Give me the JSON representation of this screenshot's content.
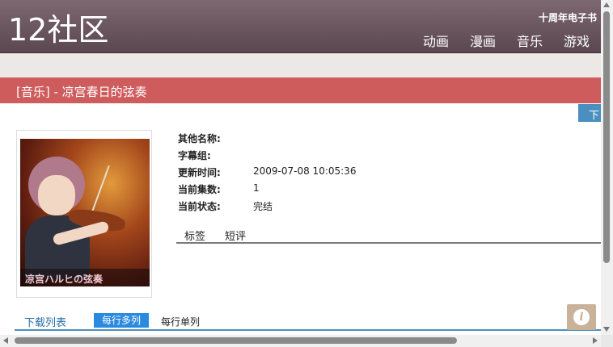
{
  "header": {
    "logo": "12社区",
    "anniversary": "十周年电子书",
    "nav": [
      "动画",
      "漫画",
      "音乐",
      "游戏"
    ]
  },
  "page": {
    "title": "[音乐] - 凉宫春日的弦奏",
    "download_tab": "下"
  },
  "cover": {
    "caption": "凉宫ハルヒの弦奏"
  },
  "info": {
    "rows": [
      {
        "label": "其他名称:",
        "value": ""
      },
      {
        "label": "字幕组:",
        "value": ""
      },
      {
        "label": "更新时间:",
        "value": "2009-07-08 10:05:36"
      },
      {
        "label": "当前集数:",
        "value": "1"
      },
      {
        "label": "当前状态:",
        "value": "完结"
      }
    ]
  },
  "tabs": [
    "标签",
    "短评"
  ],
  "download": {
    "title": "下载列表",
    "multi": "每行多列",
    "single": "每行单列"
  },
  "colors": {
    "header": "#6b5660",
    "title_bar": "#cf5c5d",
    "accent_blue": "#2a8ae0"
  }
}
